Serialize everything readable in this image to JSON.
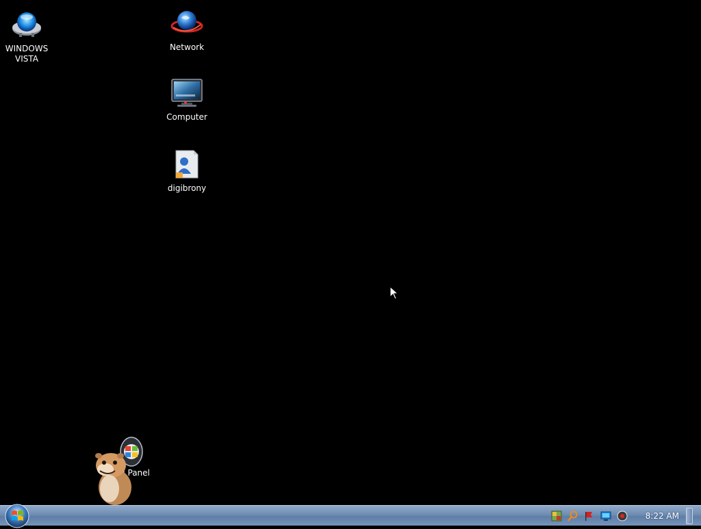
{
  "desktop": {
    "icons": [
      {
        "label": "WINDOWS\nVISTA",
        "icon": "vista-orb-icon"
      },
      {
        "label": "Network",
        "icon": "network-globe-icon"
      },
      {
        "label": "Computer",
        "icon": "computer-monitor-icon"
      },
      {
        "label": "digibrony",
        "icon": "user-folder-icon"
      },
      {
        "label": "ol Panel",
        "icon": "control-panel-icon"
      }
    ],
    "background_color": "#000000"
  },
  "taskbar": {
    "start_icon": "windows-start-orb-icon",
    "tray_icons": [
      "security-center-icon",
      "search-icon",
      "flag-icon",
      "network-monitor-icon",
      "volume-icon"
    ],
    "clock": "8:22 AM",
    "accent": "#6f8db3"
  }
}
